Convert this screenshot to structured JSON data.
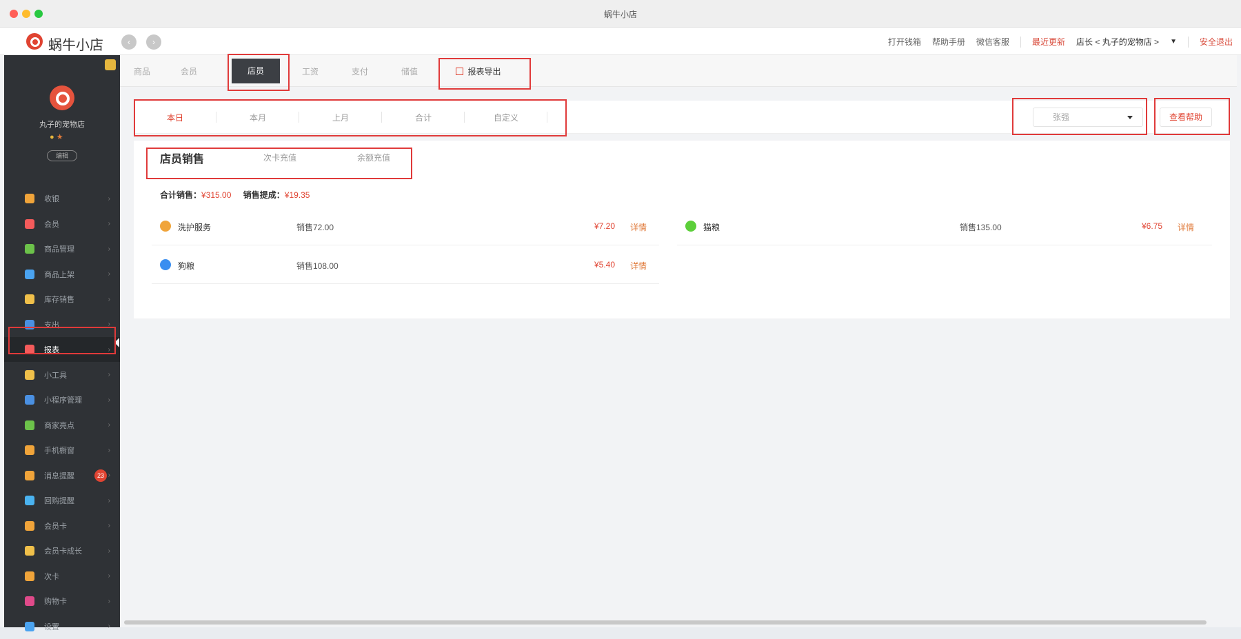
{
  "window": {
    "title": "蜗牛小店"
  },
  "header": {
    "brand": "蜗牛小店",
    "links": [
      "打开钱箱",
      "帮助手册",
      "微信客服"
    ],
    "recent_update": "最近更新",
    "store_select": "店长 < 丸子的宠物店 >",
    "logout": "安全退出"
  },
  "sidebar": {
    "store_name": "丸子的宠物店",
    "edit_label": "编辑",
    "items": [
      {
        "label": "收银",
        "icon": "cashier-icon",
        "color": "#f0a43a"
      },
      {
        "label": "会员",
        "icon": "member-icon",
        "color": "#f45b5b"
      },
      {
        "label": "商品管理",
        "icon": "goods-icon",
        "color": "#6cc24a"
      },
      {
        "label": "商品上架",
        "icon": "shelf-icon",
        "color": "#4aa3f0"
      },
      {
        "label": "库存销售",
        "icon": "stock-icon",
        "color": "#f0c04a"
      },
      {
        "label": "支出",
        "icon": "expense-icon",
        "color": "#4a90e2"
      },
      {
        "label": "报表",
        "icon": "report-icon",
        "color": "#f45b5b"
      },
      {
        "label": "小工具",
        "icon": "tools-icon",
        "color": "#f0c04a"
      },
      {
        "label": "小程序管理",
        "icon": "miniapp-icon",
        "color": "#4a90e2"
      },
      {
        "label": "商家亮点",
        "icon": "highlight-icon",
        "color": "#6cc24a"
      },
      {
        "label": "手机橱窗",
        "icon": "phone-icon",
        "color": "#f0a43a"
      },
      {
        "label": "消息提醒",
        "icon": "message-icon",
        "color": "#f0a43a",
        "badge": "23"
      },
      {
        "label": "回购提醒",
        "icon": "repurchase-icon",
        "color": "#4ab3f0"
      },
      {
        "label": "会员卡",
        "icon": "card-icon",
        "color": "#f0a43a"
      },
      {
        "label": "会员卡成长",
        "icon": "growth-icon",
        "color": "#f0c04a"
      },
      {
        "label": "次卡",
        "icon": "timecard-icon",
        "color": "#f0a43a"
      },
      {
        "label": "购物卡",
        "icon": "shoppingcard-icon",
        "color": "#e04a8a"
      },
      {
        "label": "设置",
        "icon": "settings-icon",
        "color": "#4aa3f0"
      }
    ]
  },
  "tabs": [
    "商品",
    "会员",
    "店员",
    "工资",
    "支付",
    "储值"
  ],
  "active_tab": "店员",
  "export_label": "报表导出",
  "period_tabs": [
    "本日",
    "本月",
    "上月",
    "合计",
    "自定义"
  ],
  "staff_select": {
    "value": "张强"
  },
  "help_button": "查看帮助",
  "subtabs": [
    "店员销售",
    "次卡充值",
    "余额充值"
  ],
  "summary": {
    "total_label": "合计销售：",
    "total_value": "¥315.00",
    "commission_label": "销售提成：",
    "commission_value": "¥19.35"
  },
  "rows_left": [
    {
      "name": "洗护服务",
      "sales": "销售72.00",
      "commission": "¥7.20",
      "detail": "详情",
      "color": "#f0a43a"
    },
    {
      "name": "狗粮",
      "sales": "销售108.00",
      "commission": "¥5.40",
      "detail": "详情",
      "color": "#3a8ef0"
    }
  ],
  "rows_right": [
    {
      "name": "猫粮",
      "sales": "销售135.00",
      "commission": "¥6.75",
      "detail": "详情",
      "color": "#5ccf3a"
    }
  ]
}
